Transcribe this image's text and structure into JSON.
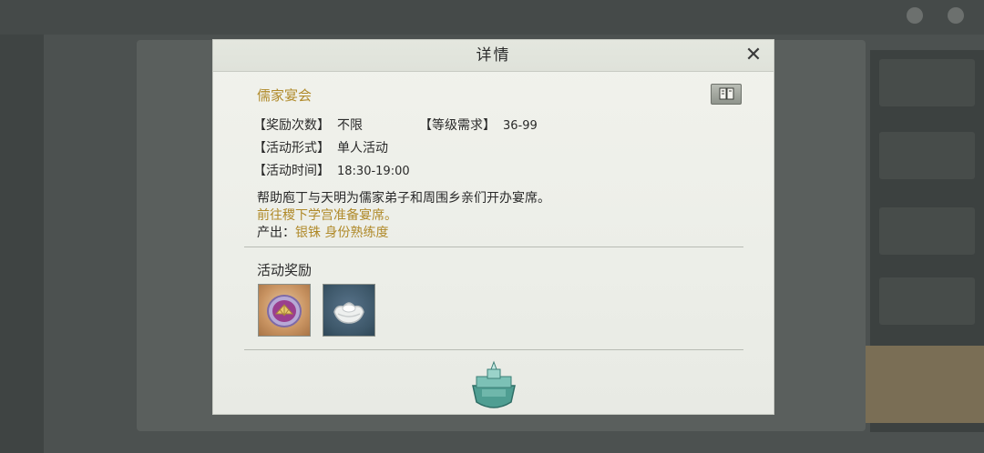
{
  "dialog": {
    "title": "详情",
    "close_symbol": "✕"
  },
  "activity": {
    "name": "儒家宴会",
    "reward_count_label": "【奖励次数】",
    "reward_count_value": "不限",
    "level_req_label": "【等级需求】",
    "level_req_value": "36-99",
    "form_label": "【活动形式】",
    "form_value": "单人活动",
    "time_label": "【活动时间】",
    "time_value": "18:30-19:00",
    "description": "帮助庖丁与天明为儒家弟子和周围乡亲们开办宴席。",
    "hint": "前往稷下学宫准备宴席。",
    "output_label": "产出：",
    "output_value": "银铢 身份熟练度"
  },
  "rewards": {
    "section_title": "活动奖励",
    "items": [
      {
        "icon": "fan-token-icon"
      },
      {
        "icon": "silver-ingot-icon"
      }
    ]
  },
  "colors": {
    "accent_gold": "#b08a2a",
    "text": "#2a2a2a",
    "dialog_bg": "#eceee8"
  }
}
